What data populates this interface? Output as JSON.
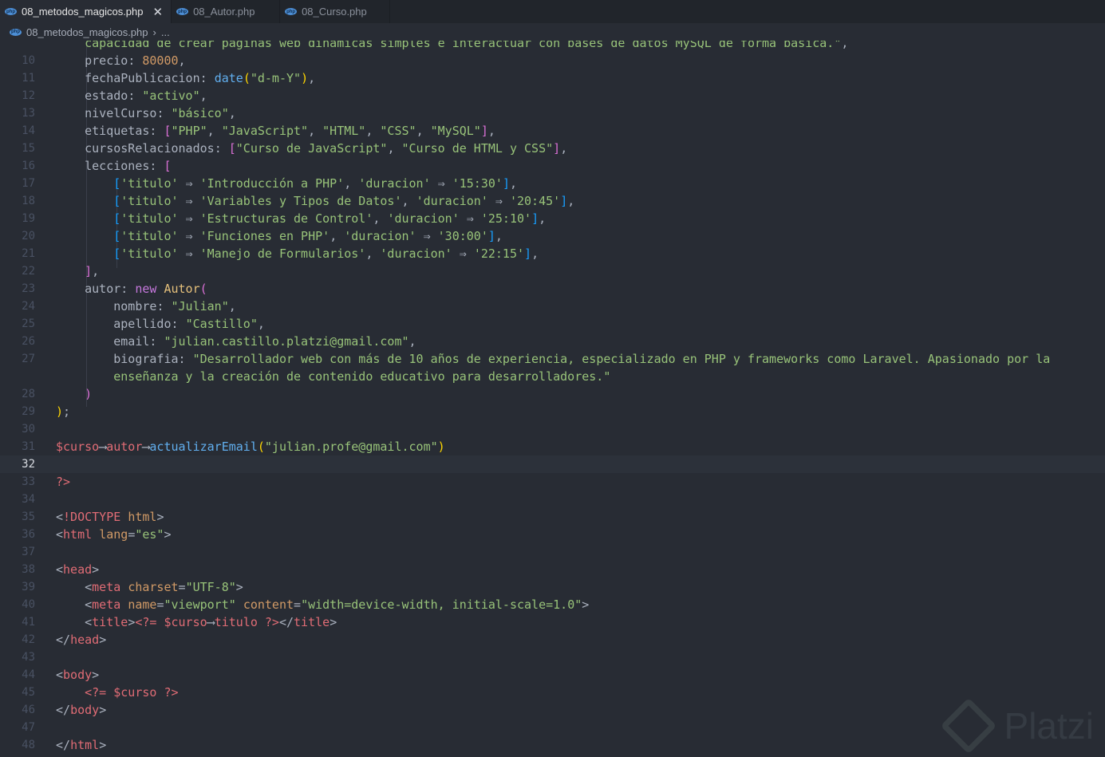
{
  "tabs": [
    {
      "label": "08_metodos_magicos.php",
      "active": true
    },
    {
      "label": "08_Autor.php",
      "active": false
    },
    {
      "label": "08_Curso.php",
      "active": false
    }
  ],
  "close_glyph": "✕",
  "breadcrumb": {
    "file": "08_metodos_magicos.php",
    "separator": "›",
    "rest": "..."
  },
  "watermark": "Platzi",
  "colors": {
    "default": "#abb2bf",
    "string": "#98c379",
    "number": "#d19a66",
    "func": "#61afef",
    "keyword": "#c678dd",
    "variable": "#e06c75",
    "class": "#e5c07b",
    "operator": "#56b6c2",
    "bracket1": "#da70d6",
    "bracket2": "#179fff",
    "bracket3": "#ffd700",
    "tag": "#e06c75",
    "attr": "#d19a66"
  },
  "lines": [
    {
      "num": "",
      "tokens": [
        [
          "    capacidad de crear páginas web dinámicas simples e interactuar con bases de datos MySQL de forma básica.\"",
          "string"
        ],
        [
          ",",
          "default"
        ]
      ]
    },
    {
      "num": "10",
      "tokens": [
        [
          "    precio",
          "default"
        ],
        [
          ": ",
          "default"
        ],
        [
          "80000",
          "number"
        ],
        [
          ",",
          "default"
        ]
      ]
    },
    {
      "num": "11",
      "tokens": [
        [
          "    fechaPublicacion",
          "default"
        ],
        [
          ": ",
          "default"
        ],
        [
          "date",
          "func"
        ],
        [
          "(",
          "bracket3"
        ],
        [
          "\"d-m-Y\"",
          "string"
        ],
        [
          ")",
          "bracket3"
        ],
        [
          ",",
          "default"
        ]
      ]
    },
    {
      "num": "12",
      "tokens": [
        [
          "    estado",
          "default"
        ],
        [
          ": ",
          "default"
        ],
        [
          "\"activo\"",
          "string"
        ],
        [
          ",",
          "default"
        ]
      ]
    },
    {
      "num": "13",
      "tokens": [
        [
          "    nivelCurso",
          "default"
        ],
        [
          ": ",
          "default"
        ],
        [
          "\"básico\"",
          "string"
        ],
        [
          ",",
          "default"
        ]
      ]
    },
    {
      "num": "14",
      "tokens": [
        [
          "    etiquetas",
          "default"
        ],
        [
          ": ",
          "default"
        ],
        [
          "[",
          "bracket1"
        ],
        [
          "\"PHP\"",
          "string"
        ],
        [
          ", ",
          "default"
        ],
        [
          "\"JavaScript\"",
          "string"
        ],
        [
          ", ",
          "default"
        ],
        [
          "\"HTML\"",
          "string"
        ],
        [
          ", ",
          "default"
        ],
        [
          "\"CSS\"",
          "string"
        ],
        [
          ", ",
          "default"
        ],
        [
          "\"MySQL\"",
          "string"
        ],
        [
          "]",
          "bracket1"
        ],
        [
          ",",
          "default"
        ]
      ]
    },
    {
      "num": "15",
      "tokens": [
        [
          "    cursosRelacionados",
          "default"
        ],
        [
          ": ",
          "default"
        ],
        [
          "[",
          "bracket1"
        ],
        [
          "\"Curso de JavaScript\"",
          "string"
        ],
        [
          ", ",
          "default"
        ],
        [
          "\"Curso de HTML y CSS\"",
          "string"
        ],
        [
          "]",
          "bracket1"
        ],
        [
          ",",
          "default"
        ]
      ]
    },
    {
      "num": "16",
      "tokens": [
        [
          "    lecciones",
          "default"
        ],
        [
          ": ",
          "default"
        ],
        [
          "[",
          "bracket1"
        ]
      ]
    },
    {
      "num": "17",
      "tokens": [
        [
          "        ",
          "default"
        ],
        [
          "[",
          "bracket2"
        ],
        [
          "'titulo'",
          "string"
        ],
        [
          " ⇒ ",
          "default"
        ],
        [
          "'Introducción a PHP'",
          "string"
        ],
        [
          ", ",
          "default"
        ],
        [
          "'duracion'",
          "string"
        ],
        [
          " ⇒ ",
          "default"
        ],
        [
          "'15:30'",
          "string"
        ],
        [
          "]",
          "bracket2"
        ],
        [
          ",",
          "default"
        ]
      ]
    },
    {
      "num": "18",
      "tokens": [
        [
          "        ",
          "default"
        ],
        [
          "[",
          "bracket2"
        ],
        [
          "'titulo'",
          "string"
        ],
        [
          " ⇒ ",
          "default"
        ],
        [
          "'Variables y Tipos de Datos'",
          "string"
        ],
        [
          ", ",
          "default"
        ],
        [
          "'duracion'",
          "string"
        ],
        [
          " ⇒ ",
          "default"
        ],
        [
          "'20:45'",
          "string"
        ],
        [
          "]",
          "bracket2"
        ],
        [
          ",",
          "default"
        ]
      ]
    },
    {
      "num": "19",
      "tokens": [
        [
          "        ",
          "default"
        ],
        [
          "[",
          "bracket2"
        ],
        [
          "'titulo'",
          "string"
        ],
        [
          " ⇒ ",
          "default"
        ],
        [
          "'Estructuras de Control'",
          "string"
        ],
        [
          ", ",
          "default"
        ],
        [
          "'duracion'",
          "string"
        ],
        [
          " ⇒ ",
          "default"
        ],
        [
          "'25:10'",
          "string"
        ],
        [
          "]",
          "bracket2"
        ],
        [
          ",",
          "default"
        ]
      ]
    },
    {
      "num": "20",
      "tokens": [
        [
          "        ",
          "default"
        ],
        [
          "[",
          "bracket2"
        ],
        [
          "'titulo'",
          "string"
        ],
        [
          " ⇒ ",
          "default"
        ],
        [
          "'Funciones en PHP'",
          "string"
        ],
        [
          ", ",
          "default"
        ],
        [
          "'duracion'",
          "string"
        ],
        [
          " ⇒ ",
          "default"
        ],
        [
          "'30:00'",
          "string"
        ],
        [
          "]",
          "bracket2"
        ],
        [
          ",",
          "default"
        ]
      ]
    },
    {
      "num": "21",
      "tokens": [
        [
          "        ",
          "default"
        ],
        [
          "[",
          "bracket2"
        ],
        [
          "'titulo'",
          "string"
        ],
        [
          " ⇒ ",
          "default"
        ],
        [
          "'Manejo de Formularios'",
          "string"
        ],
        [
          ", ",
          "default"
        ],
        [
          "'duracion'",
          "string"
        ],
        [
          " ⇒ ",
          "default"
        ],
        [
          "'22:15'",
          "string"
        ],
        [
          "]",
          "bracket2"
        ],
        [
          ",",
          "default"
        ]
      ]
    },
    {
      "num": "22",
      "tokens": [
        [
          "    ",
          "default"
        ],
        [
          "]",
          "bracket1"
        ],
        [
          ",",
          "default"
        ]
      ]
    },
    {
      "num": "23",
      "tokens": [
        [
          "    autor",
          "default"
        ],
        [
          ": ",
          "default"
        ],
        [
          "new",
          "keyword"
        ],
        [
          " ",
          "default"
        ],
        [
          "Autor",
          "class"
        ],
        [
          "(",
          "bracket1"
        ]
      ]
    },
    {
      "num": "24",
      "tokens": [
        [
          "        nombre",
          "default"
        ],
        [
          ": ",
          "default"
        ],
        [
          "\"Julian\"",
          "string"
        ],
        [
          ",",
          "default"
        ]
      ]
    },
    {
      "num": "25",
      "tokens": [
        [
          "        apellido",
          "default"
        ],
        [
          ": ",
          "default"
        ],
        [
          "\"Castillo\"",
          "string"
        ],
        [
          ",",
          "default"
        ]
      ]
    },
    {
      "num": "26",
      "tokens": [
        [
          "        email",
          "default"
        ],
        [
          ": ",
          "default"
        ],
        [
          "\"julian.castillo.platzi@gmail.com\"",
          "string"
        ],
        [
          ",",
          "default"
        ]
      ]
    },
    {
      "num": "27",
      "tokens": [
        [
          "        biografia",
          "default"
        ],
        [
          ": ",
          "default"
        ],
        [
          "\"Desarrollador web con más de 10 años de experiencia, especializado en PHP y frameworks como Laravel. Apasionado por la",
          "string"
        ]
      ]
    },
    {
      "num": "",
      "tokens": [
        [
          "        enseñanza y la creación de contenido educativo para desarrolladores.\"",
          "string"
        ]
      ]
    },
    {
      "num": "28",
      "tokens": [
        [
          "    ",
          "default"
        ],
        [
          ")",
          "bracket1"
        ]
      ]
    },
    {
      "num": "29",
      "tokens": [
        [
          ")",
          "bracket3"
        ],
        [
          ";",
          "default"
        ]
      ]
    },
    {
      "num": "30",
      "tokens": []
    },
    {
      "num": "31",
      "tokens": [
        [
          "$curso",
          "variable"
        ],
        [
          "⟶",
          "default"
        ],
        [
          "autor",
          "variable"
        ],
        [
          "⟶",
          "default"
        ],
        [
          "actualizarEmail",
          "func"
        ],
        [
          "(",
          "bracket3"
        ],
        [
          "\"julian.profe@gmail.com\"",
          "string"
        ],
        [
          ")",
          "bracket3"
        ]
      ]
    },
    {
      "num": "32",
      "tokens": [],
      "current": true
    },
    {
      "num": "33",
      "tokens": [
        [
          "?>",
          "variable"
        ]
      ]
    },
    {
      "num": "34",
      "tokens": []
    },
    {
      "num": "35",
      "tokens": [
        [
          "<",
          "default"
        ],
        [
          "!DOCTYPE",
          "tag"
        ],
        [
          " ",
          "default"
        ],
        [
          "html",
          "attr"
        ],
        [
          ">",
          "default"
        ]
      ]
    },
    {
      "num": "36",
      "tokens": [
        [
          "<",
          "default"
        ],
        [
          "html",
          "tag"
        ],
        [
          " ",
          "default"
        ],
        [
          "lang",
          "attr"
        ],
        [
          "=",
          "default"
        ],
        [
          "\"es\"",
          "string"
        ],
        [
          ">",
          "default"
        ]
      ]
    },
    {
      "num": "37",
      "tokens": []
    },
    {
      "num": "38",
      "tokens": [
        [
          "<",
          "default"
        ],
        [
          "head",
          "tag"
        ],
        [
          ">",
          "default"
        ]
      ]
    },
    {
      "num": "39",
      "tokens": [
        [
          "    <",
          "default"
        ],
        [
          "meta",
          "tag"
        ],
        [
          " ",
          "default"
        ],
        [
          "charset",
          "attr"
        ],
        [
          "=",
          "default"
        ],
        [
          "\"UTF-8\"",
          "string"
        ],
        [
          ">",
          "default"
        ]
      ]
    },
    {
      "num": "40",
      "tokens": [
        [
          "    <",
          "default"
        ],
        [
          "meta",
          "tag"
        ],
        [
          " ",
          "default"
        ],
        [
          "name",
          "attr"
        ],
        [
          "=",
          "default"
        ],
        [
          "\"viewport\"",
          "string"
        ],
        [
          " ",
          "default"
        ],
        [
          "content",
          "attr"
        ],
        [
          "=",
          "default"
        ],
        [
          "\"width=device-width, initial-scale=1.0\"",
          "string"
        ],
        [
          ">",
          "default"
        ]
      ]
    },
    {
      "num": "41",
      "tokens": [
        [
          "    <",
          "default"
        ],
        [
          "title",
          "tag"
        ],
        [
          ">",
          "default"
        ],
        [
          "<?=",
          "variable"
        ],
        [
          " ",
          "default"
        ],
        [
          "$curso",
          "variable"
        ],
        [
          "⟶",
          "default"
        ],
        [
          "titulo",
          "variable"
        ],
        [
          " ",
          "default"
        ],
        [
          "?>",
          "variable"
        ],
        [
          "</",
          "default"
        ],
        [
          "title",
          "tag"
        ],
        [
          ">",
          "default"
        ]
      ]
    },
    {
      "num": "42",
      "tokens": [
        [
          "</",
          "default"
        ],
        [
          "head",
          "tag"
        ],
        [
          ">",
          "default"
        ]
      ]
    },
    {
      "num": "43",
      "tokens": []
    },
    {
      "num": "44",
      "tokens": [
        [
          "<",
          "default"
        ],
        [
          "body",
          "tag"
        ],
        [
          ">",
          "default"
        ]
      ]
    },
    {
      "num": "45",
      "tokens": [
        [
          "    ",
          "default"
        ],
        [
          "<?=",
          "variable"
        ],
        [
          " ",
          "default"
        ],
        [
          "$curso",
          "variable"
        ],
        [
          " ",
          "default"
        ],
        [
          "?>",
          "variable"
        ]
      ]
    },
    {
      "num": "46",
      "tokens": [
        [
          "</",
          "default"
        ],
        [
          "body",
          "tag"
        ],
        [
          ">",
          "default"
        ]
      ]
    },
    {
      "num": "47",
      "tokens": []
    },
    {
      "num": "48",
      "tokens": [
        [
          "</",
          "default"
        ],
        [
          "html",
          "tag"
        ],
        [
          ">",
          "default"
        ]
      ]
    }
  ]
}
